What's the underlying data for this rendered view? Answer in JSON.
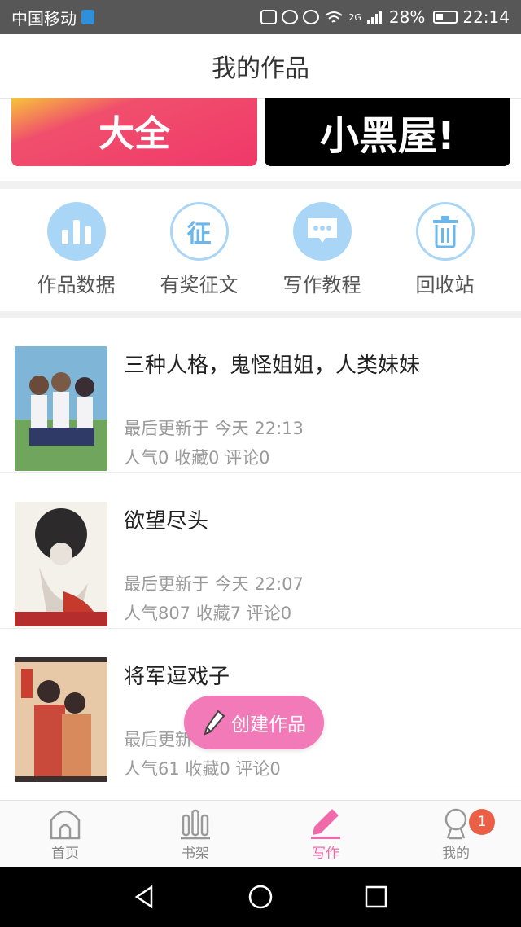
{
  "statusbar": {
    "carrier": "中国移动",
    "network": "2G",
    "battery": "28%",
    "time": "22:14"
  },
  "header": {
    "title": "我的作品"
  },
  "banners": [
    {
      "text": "大全"
    },
    {
      "text": "小黑屋!"
    }
  ],
  "quick_actions": [
    {
      "label": "作品数据",
      "icon": "bar-chart-icon"
    },
    {
      "label": "有奖征文",
      "icon": "essay-contest-icon",
      "glyph": "征"
    },
    {
      "label": "写作教程",
      "icon": "chat-bubble-icon"
    },
    {
      "label": "回收站",
      "icon": "trash-icon"
    }
  ],
  "works": [
    {
      "title": "三种人格，鬼怪姐姐，人类妹妹",
      "updated": "最后更新于 今天 22:13",
      "stats": "人气0  收藏0  评论0"
    },
    {
      "title": "欲望尽头",
      "updated": "最后更新于 今天 22:07",
      "stats": "人气807  收藏7  评论0"
    },
    {
      "title": "将军逗戏子",
      "updated": "最后更新",
      "stats": "人气61  收藏0  评论0"
    }
  ],
  "fab": {
    "label": "创建作品"
  },
  "tabs": [
    {
      "label": "首页"
    },
    {
      "label": "书架"
    },
    {
      "label": "写作"
    },
    {
      "label": "我的",
      "badge": "1"
    }
  ],
  "colors": {
    "accent": "#f06aa9",
    "icon_blue": "#a9d6f6"
  }
}
